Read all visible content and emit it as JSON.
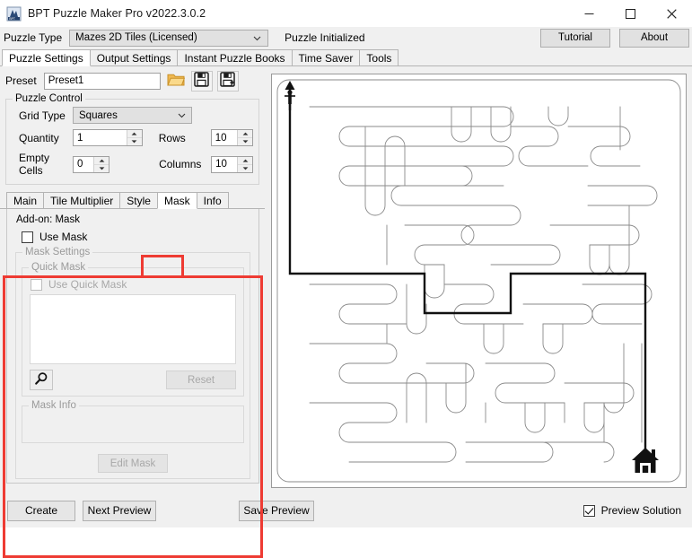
{
  "window": {
    "title": "BPT Puzzle Maker Pro v2022.3.0.2",
    "app_icon": "bpt-logo-icon",
    "minimize_label": "─",
    "maximize_label": "□",
    "close_label": "✕"
  },
  "type_row": {
    "label": "Puzzle Type",
    "selected": "Mazes 2D Tiles (Licensed)",
    "options": [
      "Mazes 2D Tiles (Licensed)"
    ],
    "status": "Puzzle Initialized",
    "tutorial_label": "Tutorial",
    "about_label": "About"
  },
  "main_tabs": [
    {
      "label": "Puzzle Settings",
      "active": true
    },
    {
      "label": "Output Settings",
      "active": false
    },
    {
      "label": "Instant Puzzle Books",
      "active": false
    },
    {
      "label": "Time Saver",
      "active": false
    },
    {
      "label": "Tools",
      "active": false
    }
  ],
  "preset": {
    "label": "Preset",
    "value": "Preset1",
    "placeholder": "Preset1",
    "open_icon": "folder-open-icon",
    "save_icon": "save-icon",
    "save_as_icon": "save-as-icon"
  },
  "puzzle_control": {
    "title": "Puzzle Control",
    "grid_type_label": "Grid Type",
    "grid_type_value": "Squares",
    "grid_type_options": [
      "Squares"
    ],
    "quantity_label": "Quantity",
    "quantity_value": "1",
    "rows_label": "Rows",
    "rows_value": "10",
    "empty_cells_label": "Empty Cells",
    "empty_cells_value": "0",
    "columns_label": "Columns",
    "columns_value": "10"
  },
  "sub_tabs": [
    {
      "label": "Main",
      "active": false
    },
    {
      "label": "Tile Multiplier",
      "active": false
    },
    {
      "label": "Style",
      "active": false
    },
    {
      "label": "Mask",
      "active": true
    },
    {
      "label": "Info",
      "active": false
    }
  ],
  "mask_panel": {
    "addon_title": "Add-on: Mask",
    "use_mask_label": "Use Mask",
    "use_mask_checked": false,
    "mask_settings_title": "Mask Settings",
    "quick_mask_title": "Quick Mask",
    "use_quick_mask_label": "Use Quick Mask",
    "use_quick_mask_checked": false,
    "browse_icon": "magnifier-icon",
    "reset_label": "Reset",
    "mask_info_title": "Mask Info",
    "edit_mask_label": "Edit Mask"
  },
  "preview": {
    "start_marker": "person-start-icon",
    "end_marker": "house-finish-icon",
    "solution_visible": true
  },
  "bottom_bar": {
    "create_label": "Create",
    "next_preview_label": "Next Preview",
    "save_preview_label": "Save Preview",
    "preview_solution_label": "Preview Solution",
    "preview_solution_checked": true
  },
  "annotations": {
    "highlight_color": "#ee3b33",
    "mask_tab_highlight": "Mask",
    "mask_panel_highlight": "Add-on: Mask panel"
  }
}
